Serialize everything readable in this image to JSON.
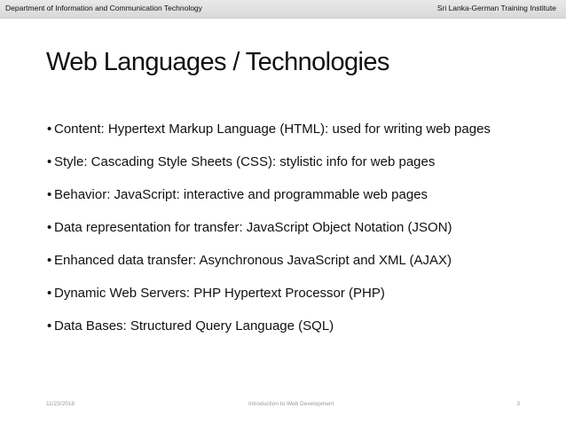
{
  "header": {
    "left": "Department of Information and Communication Technology",
    "right": "Sri Lanka-German Training Institute"
  },
  "slide": {
    "title": "Web Languages / Technologies",
    "bullets": [
      "Content: Hypertext Markup Language (HTML): used for writing web pages",
      "Style: Cascading Style Sheets (CSS): stylistic info for web pages",
      "Behavior: JavaScript: interactive and programmable web pages",
      "Data representation for transfer: JavaScript Object Notation (JSON)",
      "Enhanced data transfer: Asynchronous JavaScript and XML (AJAX)",
      "Dynamic Web Servers: PHP Hypertext Processor (PHP)",
      "Data Bases: Structured Query Language (SQL)"
    ]
  },
  "footer": {
    "date": "11/23/2018",
    "center": "Introduction to Web Development",
    "page": "3"
  }
}
